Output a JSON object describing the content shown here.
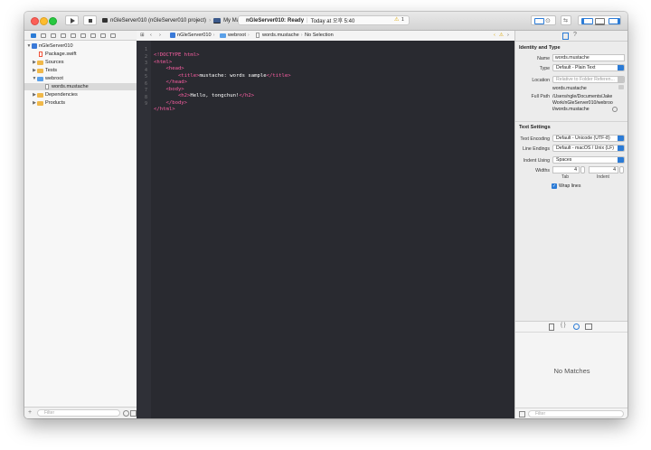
{
  "toolbar": {
    "scheme": "nGleServer010 (nGleServer010 project)",
    "destination": "My Mac",
    "status_project": "nGleServer010:",
    "status_state": "Ready",
    "status_time": "Today at 오후 5:40",
    "warnings": "1"
  },
  "navigator": {
    "items": [
      {
        "label": "nGleServer010"
      },
      {
        "label": "Package.swift"
      },
      {
        "label": "Sources"
      },
      {
        "label": "Tests"
      },
      {
        "label": "webroot"
      },
      {
        "label": "words.mustache"
      },
      {
        "label": "Dependencies"
      },
      {
        "label": "Products"
      }
    ],
    "filter_placeholder": "Filter"
  },
  "jumpbar": {
    "crumb1": "nGleServer010",
    "crumb2": "webroot",
    "crumb3": "words.mustache",
    "crumb4": "No Selection"
  },
  "editor": {
    "lines": [
      {
        "n": "1",
        "a": "<!DOCTYPE html>"
      },
      {
        "n": "2",
        "a": "<html>"
      },
      {
        "n": "3",
        "a": "    <head>"
      },
      {
        "n": "4",
        "a": "        <title>",
        "b": "mustache: words sample",
        "c": "</title>"
      },
      {
        "n": "5",
        "a": "    </head>"
      },
      {
        "n": "6",
        "a": "    <body>"
      },
      {
        "n": "7",
        "a": "        <h2>",
        "b": "Hello, tongchun!",
        "c": "</h2>"
      },
      {
        "n": "8",
        "a": "    </body>"
      },
      {
        "n": "9",
        "a": "</html>"
      }
    ]
  },
  "inspector": {
    "identity_title": "Identity and Type",
    "name_label": "Name",
    "name_value": "words.mustache",
    "type_label": "Type",
    "type_value": "Default - Plain Text",
    "location_label": "Location",
    "location_value": "Relative to Folder Referen...",
    "location_file": "words.mustache",
    "fullpath_label": "Full Path",
    "fullpath_value": "/Users/ngle/Documents/JakeWork/nGleServer010/webroot/words.mustache",
    "text_settings_title": "Text Settings",
    "encoding_label": "Text Encoding",
    "encoding_value": "Default - Unicode (UTF-8)",
    "line_endings_label": "Line Endings",
    "line_endings_value": "Default - macOS / Unix (LF)",
    "indent_using_label": "Indent Using",
    "indent_using_value": "Spaces",
    "widths_label": "Widths",
    "tab_width": "4",
    "indent_width": "4",
    "tab_label": "Tab",
    "indent_label": "Indent",
    "wrap_label": "Wrap lines",
    "no_matches": "No Matches",
    "filter_placeholder": "Filter"
  }
}
